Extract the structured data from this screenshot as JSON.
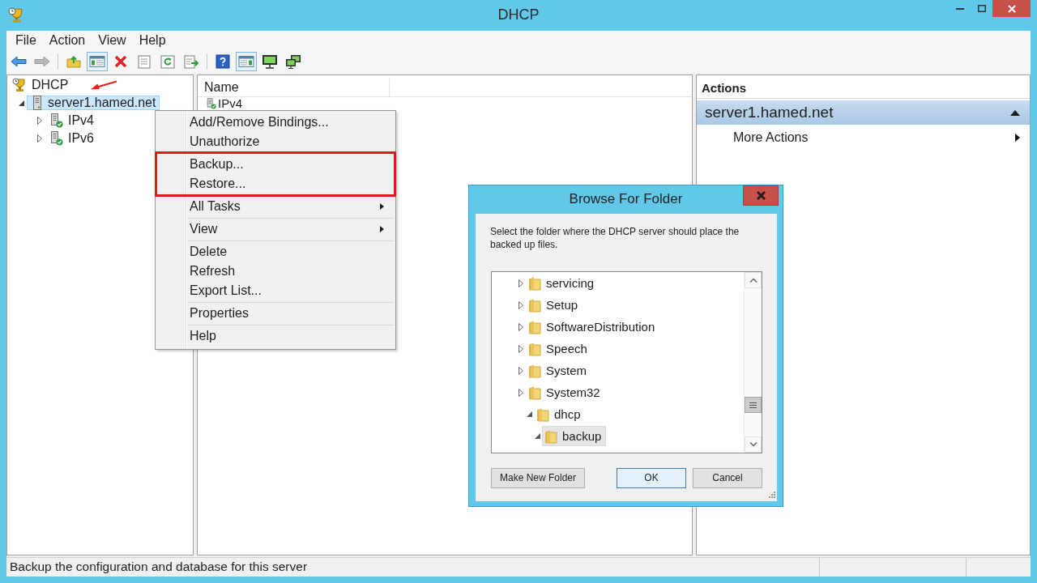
{
  "window": {
    "title": "DHCP"
  },
  "menu_bar": [
    "File",
    "Action",
    "View",
    "Help"
  ],
  "toolbar": [
    [
      {
        "kind": "back",
        "pressed": false,
        "disabled": false
      },
      {
        "kind": "forward",
        "pressed": false,
        "disabled": true
      }
    ],
    [
      {
        "kind": "up_folder",
        "pressed": false,
        "disabled": false
      },
      {
        "kind": "console_tree",
        "pressed": true,
        "disabled": false
      },
      {
        "kind": "delete",
        "pressed": false,
        "disabled": false
      },
      {
        "kind": "properties",
        "pressed": false,
        "disabled": false
      },
      {
        "kind": "refresh",
        "pressed": false,
        "disabled": false
      },
      {
        "kind": "export",
        "pressed": false,
        "disabled": false
      }
    ],
    [
      {
        "kind": "help",
        "pressed": false,
        "disabled": false
      },
      {
        "kind": "action_pane",
        "pressed": true,
        "disabled": false
      },
      {
        "kind": "monitor",
        "pressed": false,
        "disabled": false
      },
      {
        "kind": "monitor_pair",
        "pressed": false,
        "disabled": false
      }
    ]
  ],
  "tree": [
    {
      "label": "DHCP",
      "kind": "root",
      "selected": false,
      "annotated_with_arrow": true,
      "children": [
        {
          "label": "server1.hamed.net",
          "kind": "server",
          "selected": true,
          "expanded": true,
          "children": [
            {
              "label": "IPv4",
              "kind": "scope",
              "selected": false,
              "expanded": false
            },
            {
              "label": "IPv6",
              "kind": "scope",
              "selected": false,
              "expanded": false
            }
          ]
        }
      ]
    }
  ],
  "list": {
    "columns": [
      "Name"
    ],
    "rows": [
      "IPv4"
    ]
  },
  "actions_pane": {
    "title": "Actions",
    "sections": [
      {
        "title": "server1.hamed.net",
        "expanded": true,
        "items": [
          {
            "label": "More Actions",
            "submenu": true
          }
        ]
      }
    ]
  },
  "context_menu": {
    "groups": [
      {
        "items": [
          {
            "label": "Add/Remove Bindings...",
            "submenu": false
          },
          {
            "label": "Unauthorize",
            "submenu": false
          }
        ]
      },
      {
        "highlighted": true,
        "items": [
          {
            "label": "Backup...",
            "submenu": false
          },
          {
            "label": "Restore...",
            "submenu": false
          }
        ]
      },
      {
        "items": [
          {
            "label": "All Tasks",
            "submenu": true
          }
        ]
      },
      {
        "items": [
          {
            "label": "View",
            "submenu": true
          }
        ]
      },
      {
        "items": [
          {
            "label": "Delete",
            "submenu": false
          },
          {
            "label": "Refresh",
            "submenu": false
          },
          {
            "label": "Export List...",
            "submenu": false
          }
        ]
      },
      {
        "items": [
          {
            "label": "Properties",
            "submenu": false
          }
        ]
      },
      {
        "items": [
          {
            "label": "Help",
            "submenu": false
          }
        ]
      }
    ]
  },
  "dialog": {
    "title": "Browse For Folder",
    "message": "Select the folder where the DHCP server should place the backed up files.",
    "folders": [
      {
        "label": "servicing",
        "expanded": false,
        "selected": false
      },
      {
        "label": "Setup",
        "expanded": false,
        "selected": false
      },
      {
        "label": "SoftwareDistribution",
        "expanded": false,
        "selected": false
      },
      {
        "label": "Speech",
        "expanded": false,
        "selected": false
      },
      {
        "label": "System",
        "expanded": false,
        "selected": false
      },
      {
        "label": "System32",
        "expanded": false,
        "selected": false,
        "children": [
          {
            "label": "dhcp",
            "expanded": true,
            "selected": false,
            "children": [
              {
                "label": "backup",
                "expanded": true,
                "selected": true
              }
            ]
          }
        ]
      }
    ],
    "buttons": [
      {
        "label": "Make New Folder",
        "default": false
      },
      {
        "label": "OK",
        "default": true
      },
      {
        "label": "Cancel",
        "default": false
      }
    ]
  },
  "status_bar": {
    "text": "Backup the configuration and database for this server"
  }
}
